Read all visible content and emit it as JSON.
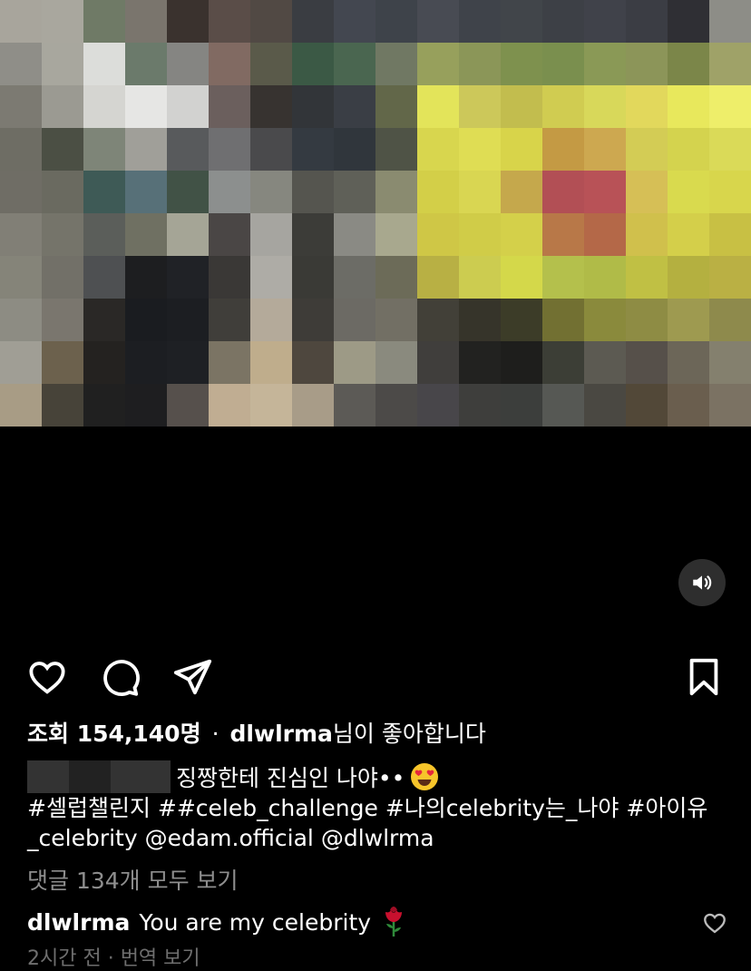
{
  "video": {
    "pixel_colors": [
      "#a8a59c",
      "#a9a79e",
      "#6f7a66",
      "#7a756d",
      "#3a322e",
      "#5a4d48",
      "#514944",
      "#3a3d42",
      "#434750",
      "#3e434a",
      "#484b53",
      "#3f434a",
      "#41454a",
      "#3d4046",
      "#40424a",
      "#3b3d44",
      "#2f2f34",
      "#8d8d87",
      "#8f8e88",
      "#a8a79e",
      "#dcddda",
      "#6b7a6b",
      "#858582",
      "#816a62",
      "#5a5a4a",
      "#3b5945",
      "#4a6650",
      "#707863",
      "#97a05c",
      "#8b9658",
      "#7e914e",
      "#7a8f4e",
      "#8a9956",
      "#8c9559",
      "#7b8649",
      "#9fa268",
      "#7c7a72",
      "#9b9a92",
      "#d5d5d1",
      "#e6e6e4",
      "#d2d2d0",
      "#6b5f5d",
      "#373330",
      "#323539",
      "#3a3e45",
      "#626749",
      "#e3e45a",
      "#ccc85a",
      "#c2bd4e",
      "#d0cc51",
      "#d8d85a",
      "#e2d85c",
      "#e8e85c",
      "#eeee6a",
      "#6e6d64",
      "#4b4f44",
      "#7e8578",
      "#a09f99",
      "#585a5c",
      "#6f6f71",
      "#4a4a4c",
      "#343a41",
      "#30363c",
      "#4f5346",
      "#d8d64e",
      "#dfdd54",
      "#d8d44a",
      "#c49a44",
      "#cda850",
      "#d3cc55",
      "#d4d34e",
      "#dada58",
      "#6f6d65",
      "#6a6a60",
      "#3e5a56",
      "#577078",
      "#415246",
      "#8c8f8e",
      "#86877f",
      "#55554f",
      "#5f6058",
      "#8a8b70",
      "#d3cf48",
      "#d9d652",
      "#c5a84c",
      "#b24f55",
      "#b85257",
      "#d6bf56",
      "#d9da4e",
      "#d8d64c",
      "#817f76",
      "#75746a",
      "#5b5e5a",
      "#6f7062",
      "#a5a596",
      "#4a4645",
      "#a6a5a0",
      "#3c3c38",
      "#8a8a84",
      "#a8a88e",
      "#cfc746",
      "#d0cc48",
      "#d4d04a",
      "#b87848",
      "#b46848",
      "#d0c04c",
      "#d4cf4a",
      "#c8c044",
      "#858479",
      "#727068",
      "#4e5052",
      "#1d1e20",
      "#202226",
      "#3a3836",
      "#aeaca6",
      "#3a3a36",
      "#6c6c66",
      "#6c6b58",
      "#b8b044",
      "#cccc50",
      "#d4d84a",
      "#b4c04c",
      "#b0bb48",
      "#c0c044",
      "#b4b040",
      "#bab044",
      "#8d8c83",
      "#7a766e",
      "#2a2826",
      "#1a1c20",
      "#1c1e22",
      "#403e3a",
      "#b4aa9a",
      "#3e3c38",
      "#6c6a64",
      "#726f64",
      "#424038",
      "#36342a",
      "#3c3c28",
      "#727032",
      "#8a8a3c",
      "#8e8c44",
      "#9e9a50",
      "#8e8a4c",
      "#a09e95",
      "#6c614d",
      "#242220",
      "#1c1e22",
      "#1e2024",
      "#7b7464",
      "#bfad8c",
      "#4e473e",
      "#9d9a86",
      "#8a8a7e",
      "#403e3c",
      "#222220",
      "#1e1e1c",
      "#3c3e36",
      "#5c5a52",
      "#56504a",
      "#6c6658",
      "#84806e",
      "#a89c85",
      "#474339",
      "#202020",
      "#1e1e20",
      "#56504c",
      "#c0ad92",
      "#c5b599",
      "#a89c88",
      "#5c5a56",
      "#4c4a48",
      "#48464a",
      "#3e3e3c",
      "#3c3e3c",
      "#565854",
      "#4a4842",
      "#524838",
      "#6a5e4e",
      "#7b7263"
    ]
  },
  "icons": {
    "sound": "speaker-icon",
    "like": "heart-icon",
    "comment": "comment-icon",
    "share": "paper-plane-icon",
    "save": "bookmark-icon",
    "emoji": "heart-eyes-emoji-icon",
    "rose": "rose-emoji-icon",
    "comment_like": "small-heart-icon"
  },
  "post": {
    "views_label": "조회 154,140명",
    "separator": "·",
    "liker_username": "dlwlrma",
    "liked_suffix": "님이 좋아합니다",
    "caption_text": "징짱한테 진심인 나야••",
    "caption_hashtags": "#셀럽챌린지 ##celeb_challenge #나의celebrity는_나야 #아이유_celebrity @edam.official @dlwlrma",
    "view_comments": "댓글 134개 모두 보기"
  },
  "comment": {
    "username": "dlwlrma",
    "text": "You are my celebrity"
  },
  "peek_text": "2시간 전 · 번역 보기"
}
